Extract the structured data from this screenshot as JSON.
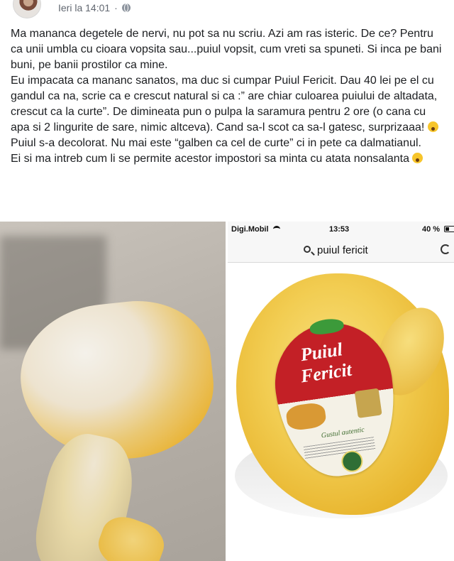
{
  "post": {
    "timestamp": "Ieri la 14:01",
    "audience_icon": "globe-icon",
    "paragraphs": [
      "Ma mananca degetele de nervi, nu pot sa nu scriu. Azi am ras isteric. De ce? Pentru ca unii umbla cu cioara vopsita sau...puiul vopsit, cum vreti sa spuneti. Si inca pe bani buni, pe banii prostilor ca mine.",
      "Eu impacata ca mananc sanatos, ma duc si cumpar Puiul Fericit. Dau 40 lei pe el cu gandul ca na, scrie ca e crescut natural si ca :” are chiar culoarea puiului de altadata, crescut ca la curte”. De dimineata pun o pulpa la saramura pentru 2 ore (o cana cu apa si 2 lingurite de sare, nimic altceva). Cand sa-l scot ca sa-l gatesc, surprizaaa!",
      "Puiul s-a decolorat. Nu mai este “galben ca cel de curte” ci in pete ca dalmatianul.",
      "Ei si ma intreb cum li se permite acestor impostori sa minta cu atata nonsalanta"
    ],
    "emoji_icons": [
      "shocked-face-icon",
      "confused-face-icon"
    ]
  },
  "phone": {
    "carrier": "Digi.Mobil",
    "time": "13:53",
    "battery": "40 %",
    "search_query": "puiul fericit"
  },
  "product_label": {
    "brand_line1": "Puiul",
    "brand_line2": "Fericit",
    "subtitle": "Gustul autentic"
  }
}
